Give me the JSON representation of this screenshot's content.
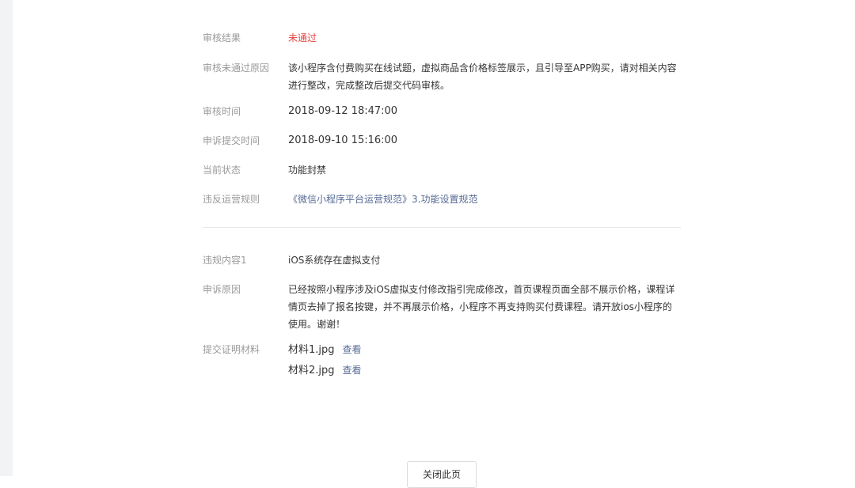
{
  "audit": {
    "result_label": "审核结果",
    "result_value": "未通过",
    "reason_label": "审核未通过原因",
    "reason_value": "该小程序含付费购买在线试题，虚拟商品含价格标签展示，且引导至APP购买，请对相关内容进行整改，完成整改后提交代码审核。",
    "time_label": "审核时间",
    "time_value": "2018-09-12 18:47:00",
    "appeal_time_label": "申诉提交时间",
    "appeal_time_value": "2018-09-10 15:16:00",
    "status_label": "当前状态",
    "status_value": "功能封禁",
    "rule_label": "违反运营规则",
    "rule_value": "《微信小程序平台运营规范》3.功能设置规范"
  },
  "violation": {
    "content_label": "违规内容1",
    "content_value": "iOS系统存在虚拟支付",
    "appeal_reason_label": "申诉原因",
    "appeal_reason_value": "已经按照小程序涉及iOS虚拟支付修改指引完成修改，首页课程页面全部不展示价格，课程详情页去掉了报名按键，并不再展示价格，小程序不再支持购买付费课程。请开放ios小程序的使用。谢谢！",
    "materials_label": "提交证明材料",
    "materials": [
      {
        "name": "材料1.jpg",
        "action": "查看"
      },
      {
        "name": "材料2.jpg",
        "action": "查看"
      }
    ]
  },
  "footer": {
    "close_label": "关闭此页"
  },
  "colors": {
    "fail": "#e64340",
    "link": "#576b95",
    "label": "#9a9a9a"
  }
}
